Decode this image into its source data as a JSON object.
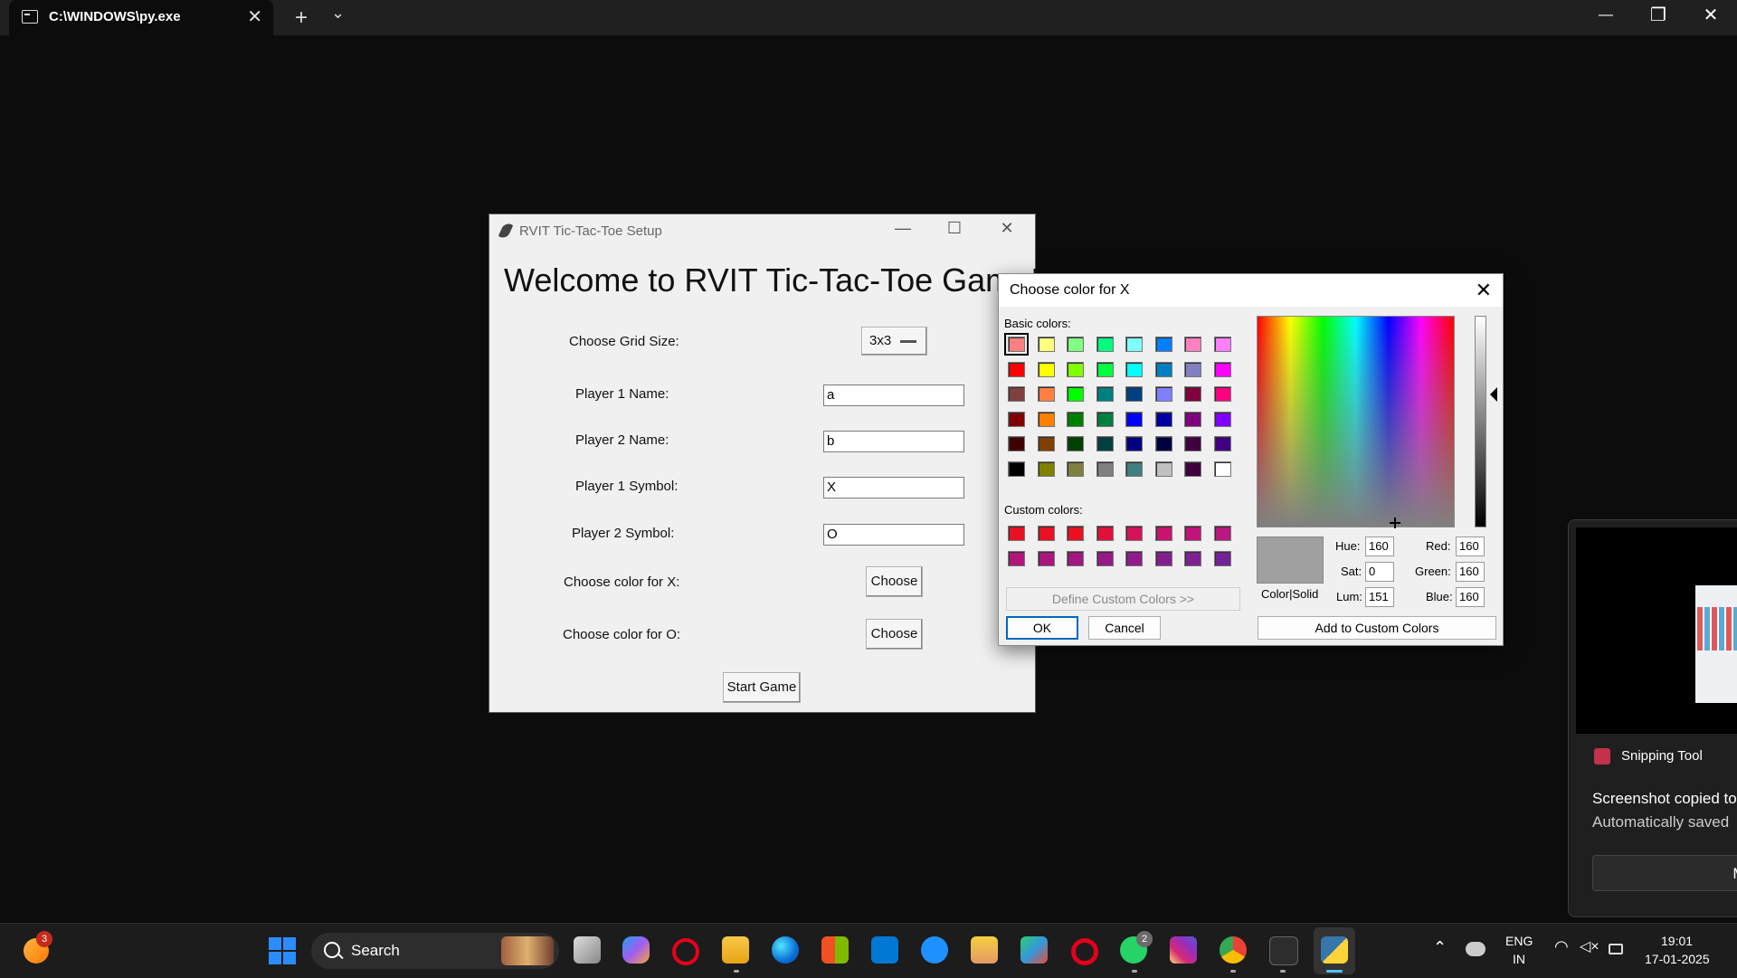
{
  "terminal": {
    "tab_title": "C:\\WINDOWS\\py.exe",
    "new_tab": "+",
    "dropdown": "⌄",
    "minimize": "—",
    "restore": "❐",
    "close": "✕"
  },
  "setup_window": {
    "title": "RVIT Tic-Tac-Toe Setup",
    "minimize": "—",
    "maximize": "☐",
    "close": "✕",
    "welcome": "Welcome to RVIT Tic-Tac-Toe Game!",
    "grid_label": "Choose Grid Size:",
    "grid_value": "3x3",
    "player1_name_label": "Player 1 Name:",
    "player1_name_value": "a",
    "player2_name_label": "Player 2 Name:",
    "player2_name_value": "b",
    "player1_symbol_label": "Player 1 Symbol:",
    "player1_symbol_value": "X",
    "player2_symbol_label": "Player 2 Symbol:",
    "player2_symbol_value": "O",
    "color_x_label": "Choose color for X:",
    "color_o_label": "Choose color for O:",
    "choose_button": "Choose",
    "start_button": "Start Game"
  },
  "color_dialog": {
    "title": "Choose color for X",
    "close": "✕",
    "basic_colors_label": "Basic colors:",
    "basic_colors": [
      [
        "#ff8080",
        "#ffff80",
        "#80ff80",
        "#00ff80",
        "#80ffff",
        "#0080ff",
        "#ff80c0",
        "#ff80ff"
      ],
      [
        "#ff0000",
        "#ffff00",
        "#80ff00",
        "#00ff40",
        "#00ffff",
        "#0080c0",
        "#8080c0",
        "#ff00ff"
      ],
      [
        "#804040",
        "#ff8040",
        "#00ff00",
        "#008080",
        "#004080",
        "#8080ff",
        "#800040",
        "#ff0080"
      ],
      [
        "#800000",
        "#ff8000",
        "#008000",
        "#008040",
        "#0000ff",
        "#0000a0",
        "#800080",
        "#8000ff"
      ],
      [
        "#400000",
        "#804000",
        "#004000",
        "#004040",
        "#000080",
        "#000040",
        "#400040",
        "#400080"
      ],
      [
        "#000000",
        "#808000",
        "#808040",
        "#808080",
        "#408080",
        "#c0c0c0",
        "#400040",
        "#ffffff"
      ]
    ],
    "custom_colors_label": "Custom colors:",
    "custom_colors": [
      [
        "#e81123",
        "#e81123",
        "#e81123",
        "#e0103a",
        "#d4145a",
        "#c8146e",
        "#c01478",
        "#b81880"
      ],
      [
        "#b0167a",
        "#a8167e",
        "#a01880",
        "#961a86",
        "#8e1c8a",
        "#841e8e",
        "#7c2092",
        "#702296"
      ]
    ],
    "define_custom": "Define Custom Colors >>",
    "ok": "OK",
    "cancel": "Cancel",
    "color_solid": "Color|Solid",
    "hue_label": "Hue:",
    "hue": "160",
    "sat_label": "Sat:",
    "sat": "0",
    "lum_label": "Lum:",
    "lum": "151",
    "red_label": "Red:",
    "red": "160",
    "green_label": "Green:",
    "green": "160",
    "blue_label": "Blue:",
    "blue": "160",
    "add_custom": "Add to Custom Colors"
  },
  "notification": {
    "app": "Snipping Tool",
    "line1": "Screenshot copied to",
    "line2": "Automatically saved",
    "button": "Ma"
  },
  "taskbar": {
    "search": "Search",
    "start_badge": "3",
    "whatsapp_badge": "2",
    "lang1": "ENG",
    "lang2": "IN",
    "time": "19:01",
    "date": "17-01-2025"
  }
}
